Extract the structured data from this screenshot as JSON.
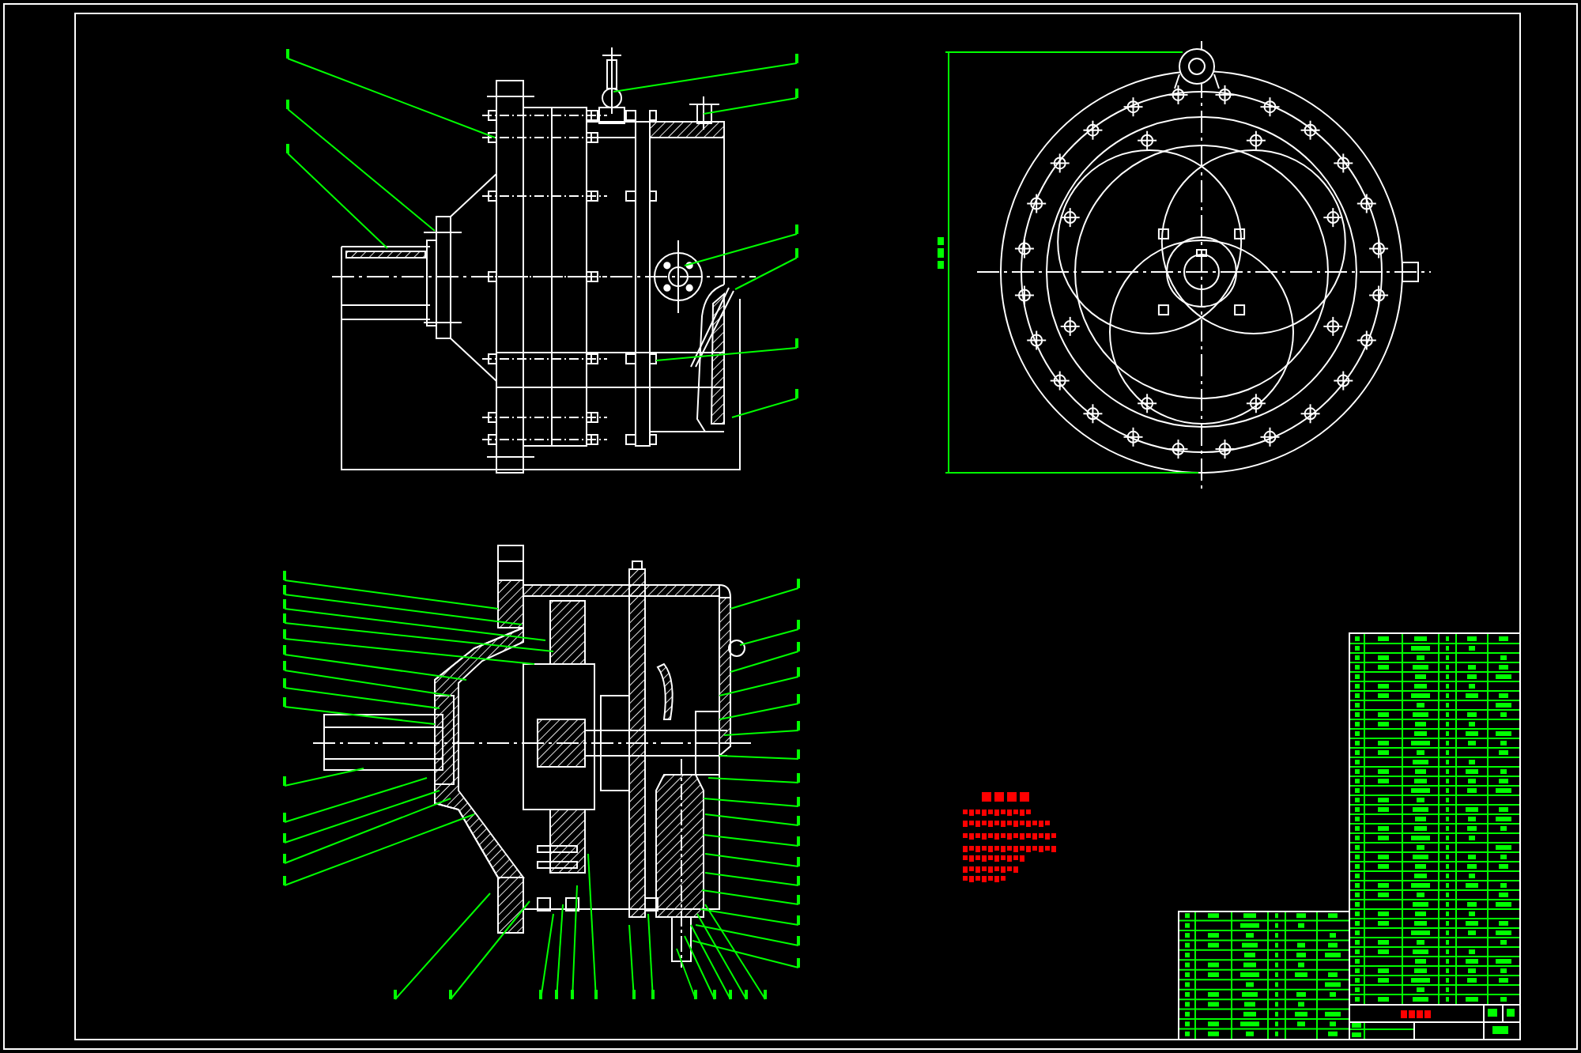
{
  "drawing_sheet": {
    "items": [
      {
        "kind": "side_view"
      },
      {
        "kind": "end_view"
      },
      {
        "kind": "section_view"
      },
      {
        "kind": "notes"
      },
      {
        "kind": "title_block"
      }
    ]
  }
}
